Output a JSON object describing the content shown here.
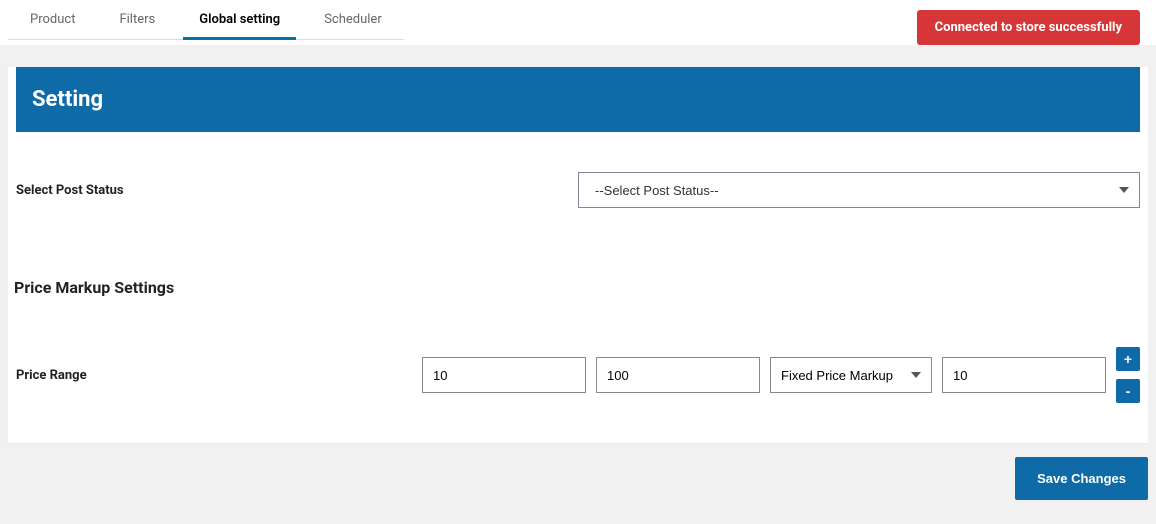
{
  "tabs": {
    "items": [
      {
        "label": "Product",
        "active": false
      },
      {
        "label": "Filters",
        "active": false
      },
      {
        "label": "Global setting",
        "active": true
      },
      {
        "label": "Scheduler",
        "active": false
      }
    ]
  },
  "status_banner": "Connected to store successfully",
  "panel": {
    "title": "Setting",
    "post_status": {
      "label": "Select Post Status",
      "placeholder": "--Select Post Status--"
    },
    "price_markup": {
      "title": "Price Markup Settings",
      "range_label": "Price Range",
      "min": "10",
      "max": "100",
      "markup_type": "Fixed Price Markup",
      "markup_value": "10",
      "add_label": "+",
      "remove_label": "-"
    }
  },
  "footer": {
    "save_label": "Save Changes"
  }
}
